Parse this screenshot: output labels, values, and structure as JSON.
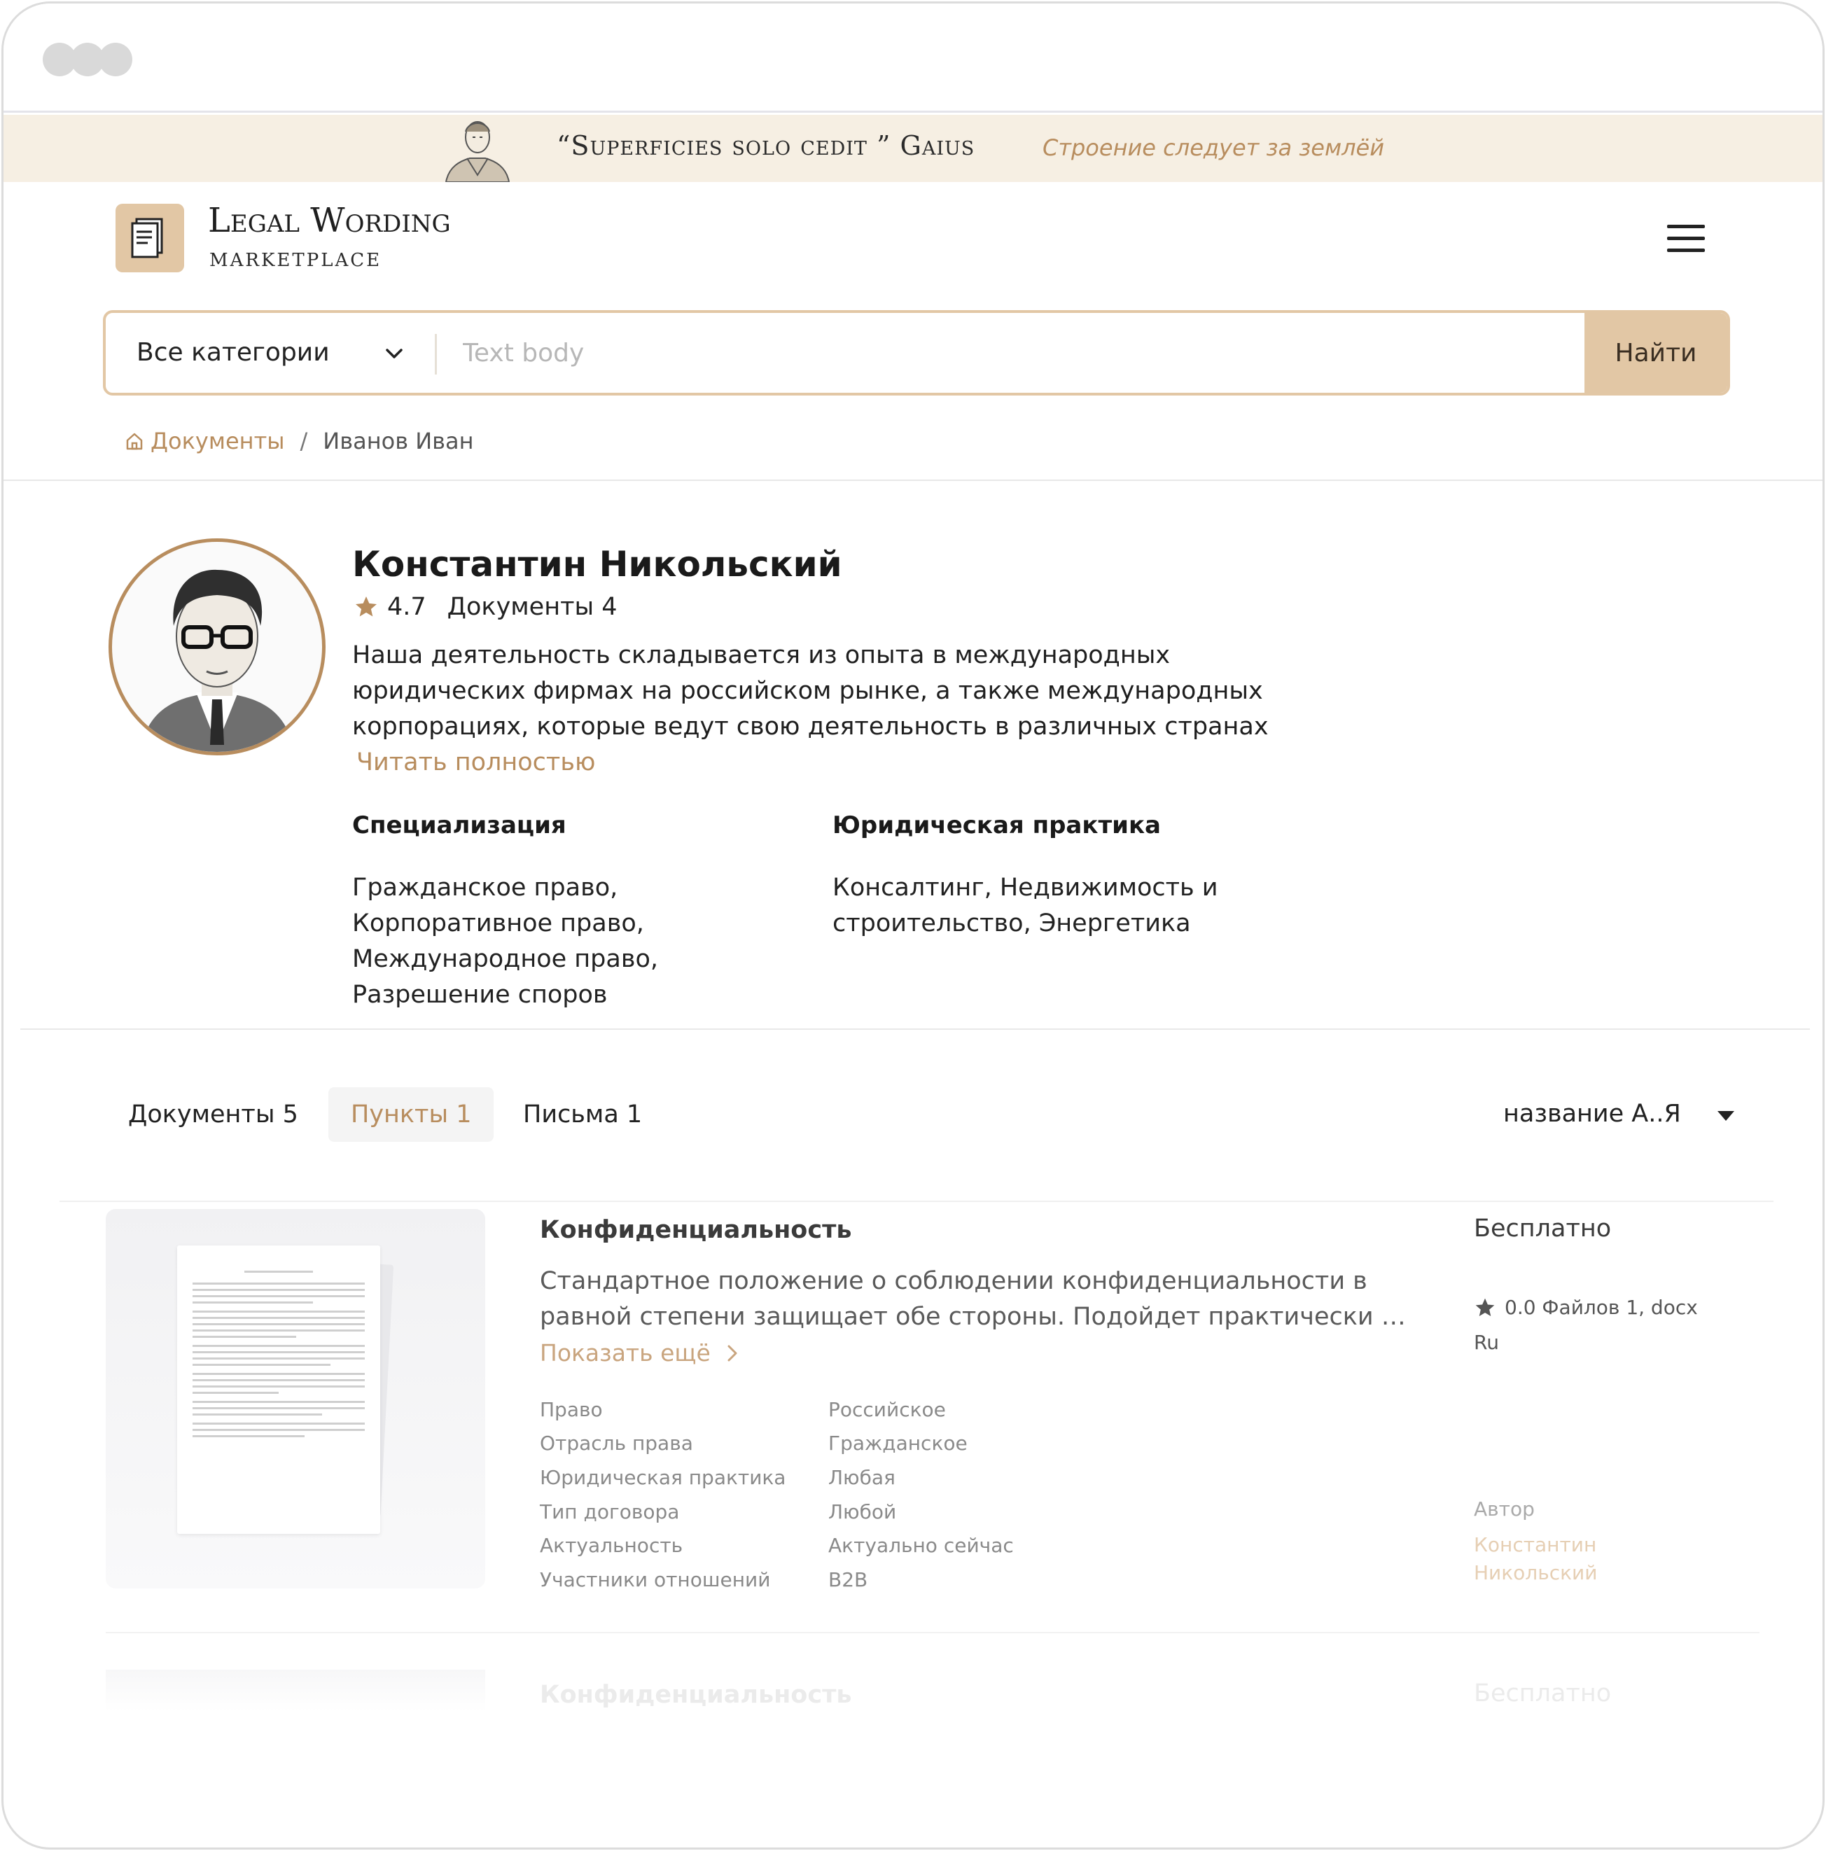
{
  "banner": {
    "quote_latin": "“Superficies solo cedit ” Gaius",
    "quote_ru": "Строение следует за землёй"
  },
  "header": {
    "logo_title": "Legal Wording",
    "logo_subtitle": "MARKETPLACE"
  },
  "search": {
    "category": "Все категории",
    "placeholder": "Text body",
    "button": "Найти"
  },
  "breadcrumb": {
    "home": "Документы",
    "current": "Иванов Иван"
  },
  "profile": {
    "name": "Константин Никольский",
    "rating": "4.7",
    "documents": "Документы 4",
    "about": "Наша деятельность складывается из опыта в международных юридических фирмах на российском рынке, а также международных корпорациях, которые ведут свою деятельность в различных странах",
    "read_more": "Читать полностью",
    "specialization_label": "Специализация",
    "specialization": "Гражданское право, Корпоративное право, Международное право, Разрешение споров",
    "practice_label": "Юридическая практика",
    "practice": "Консалтинг, Недвижимость и строительство, Энергетика"
  },
  "tabs": [
    {
      "label": "Документы 5"
    },
    {
      "label": "Пункты 1"
    },
    {
      "label": "Письма 1"
    }
  ],
  "sort": {
    "label": "название А..Я"
  },
  "card": {
    "title": "Конфиденциальность",
    "desc_line1": "Стандартное положение о соблюдении конфиденциальности в",
    "desc_line2": "равной степени защищает обе стороны. Подойдет практически дл...",
    "show_more": "Показать ещё",
    "attributes": [
      {
        "key": "Право",
        "value": "Российское"
      },
      {
        "key": "Отрасль права",
        "value": "Гражданское"
      },
      {
        "key": "Юридическая практика",
        "value": "Любая"
      },
      {
        "key": "Тип договора",
        "value": "Любой"
      },
      {
        "key": "Актуальность",
        "value": "Актуально сейчас"
      },
      {
        "key": "Участники отношений",
        "value": "B2B"
      }
    ],
    "price": "Бесплатно",
    "rating_meta": "0.0 Файлов 1, docx",
    "language": "Ru",
    "author_label": "Автор",
    "author_name": "Константин Никольский"
  },
  "next_card": {
    "title": "Конфиденциальность",
    "price": "Бесплатно"
  },
  "colors": {
    "accent": "#b88d5e",
    "accent_light": "#e2c7a5",
    "banner_bg": "#f6efe3"
  }
}
